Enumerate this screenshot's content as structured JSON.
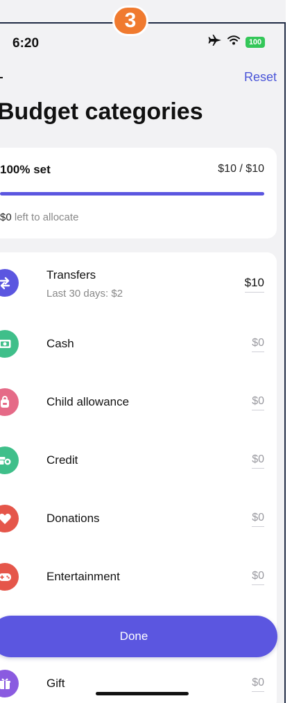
{
  "step_badge": "3",
  "status_bar": {
    "time": "6:20",
    "icons": [
      "airplane-icon",
      "wifi-icon",
      "battery-icon"
    ],
    "battery": "100"
  },
  "header": {
    "reset_label": "Reset",
    "title": "Budget categories"
  },
  "summary": {
    "percent_label": "100% set",
    "amount_ratio": "$10 / $10",
    "progress_fraction": 1.0,
    "left_amount": "$0",
    "left_text": " left to allocate"
  },
  "categories": [
    {
      "name": "Transfers",
      "sub": "Last 30 days: $2",
      "value": "$10",
      "icon": "transfer-arrows-icon",
      "color": "#5b56e0"
    },
    {
      "name": "Cash",
      "value": "$0",
      "icon": "cash-icon",
      "color": "#3fbf8a"
    },
    {
      "name": "Child allowance",
      "value": "$0",
      "icon": "backpack-icon",
      "color": "#e56a87"
    },
    {
      "name": "Credit",
      "value": "$0",
      "icon": "credit-icon",
      "color": "#3fbf8a"
    },
    {
      "name": "Donations",
      "value": "$0",
      "icon": "heart-icon",
      "color": "#e5564a"
    },
    {
      "name": "Entertainment",
      "value": "$0",
      "icon": "gamepad-icon",
      "color": "#e5564a"
    },
    {
      "name": "Gift",
      "value": "$0",
      "icon": "gift-icon",
      "color": "#8a5be0"
    }
  ],
  "done_label": "Done",
  "colors": {
    "accent": "#5b56e0",
    "badge": "#f07a2f",
    "background": "#f2f2f4"
  }
}
